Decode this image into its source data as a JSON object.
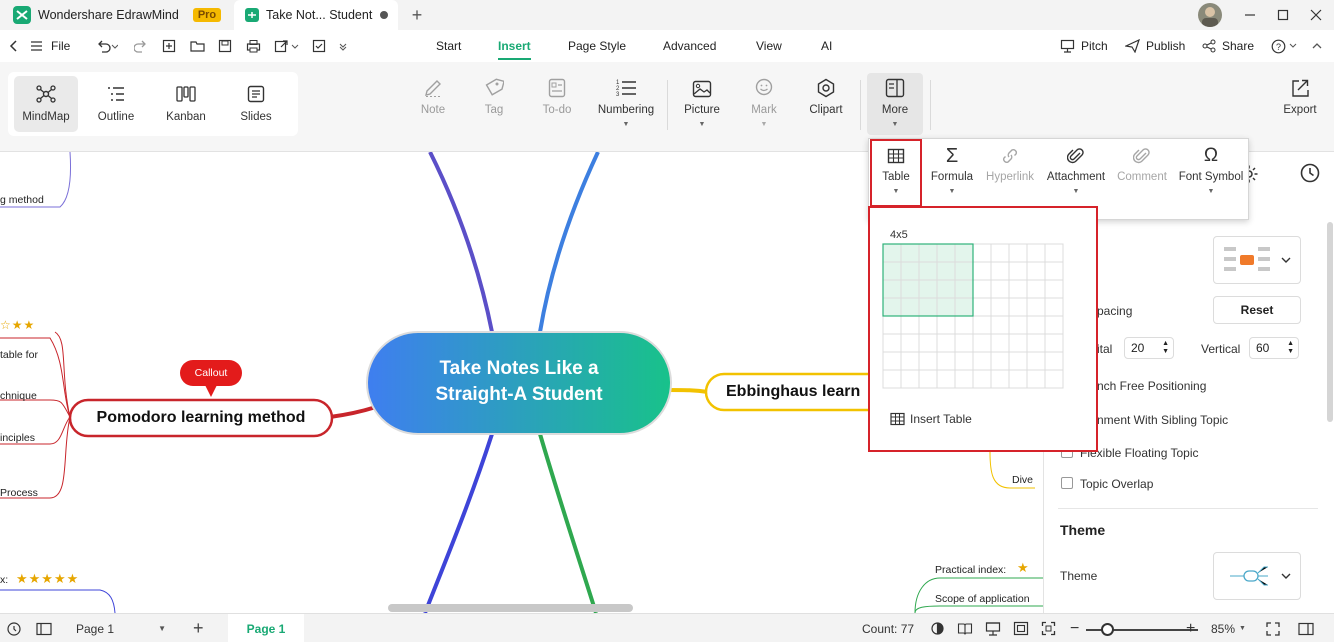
{
  "titlebar": {
    "app_name": "Wondershare EdrawMind",
    "pro_badge": "Pro",
    "doc_tab": "Take Not... Student"
  },
  "menubar": {
    "file": "File",
    "ribbon_tabs": [
      "Start",
      "Insert",
      "Page Style",
      "Advanced",
      "View",
      "AI"
    ],
    "active_tab": "Insert",
    "pitch": "Pitch",
    "publish": "Publish",
    "share": "Share"
  },
  "views": [
    "MindMap",
    "Outline",
    "Kanban",
    "Slides"
  ],
  "ribbon": {
    "note": "Note",
    "tag": "Tag",
    "todo": "To-do",
    "numbering": "Numbering",
    "picture": "Picture",
    "mark": "Mark",
    "clipart": "Clipart",
    "more": "More",
    "export": "Export"
  },
  "more_menu": {
    "table": "Table",
    "formula": "Formula",
    "hyperlink": "Hyperlink",
    "attachment": "Attachment",
    "comment": "Comment",
    "font_symbol": "Font Symbol"
  },
  "table_popup": {
    "size_label": "4x5",
    "insert_label": "Insert Table",
    "selected_cols": 5,
    "selected_rows": 4,
    "grid_cols": 10,
    "grid_rows": 8
  },
  "mindmap": {
    "central": [
      "Take Notes Like a",
      "Straight-A Student"
    ],
    "pomodoro": "Pomodoro learning method",
    "callout": "Callout",
    "ebbinghaus": "Ebbinghaus learn",
    "left_labels": [
      "g method",
      "table for",
      "chnique",
      "inciples",
      "Process",
      "x:"
    ],
    "right_labels": [
      "Dive",
      "Practical index:",
      "Scope of application"
    ]
  },
  "right_panel": {
    "spacing": "pacing",
    "reset": "Reset",
    "horizontal_label": "ital",
    "horizontal_value": "20",
    "vertical_label": "Vertical",
    "vertical_value": "60",
    "branch_free": "nch Free Positioning",
    "align_sibling": "nment With Sibling Topic",
    "flexible": "Flexible Floating Topic",
    "overlap": "Topic Overlap",
    "theme_heading": "Theme",
    "theme_label": "Theme"
  },
  "statusbar": {
    "page_select": "Page 1",
    "page_tab": "Page 1",
    "count": "Count: 77",
    "zoom": "85%"
  },
  "colors": {
    "accent": "#19a974",
    "highlight_red": "#d6232a",
    "pomodoro_red": "#c8252b",
    "ebbinghaus_yellow": "#f2c200",
    "central_start": "#3f7ef0",
    "central_end": "#18c28a"
  }
}
